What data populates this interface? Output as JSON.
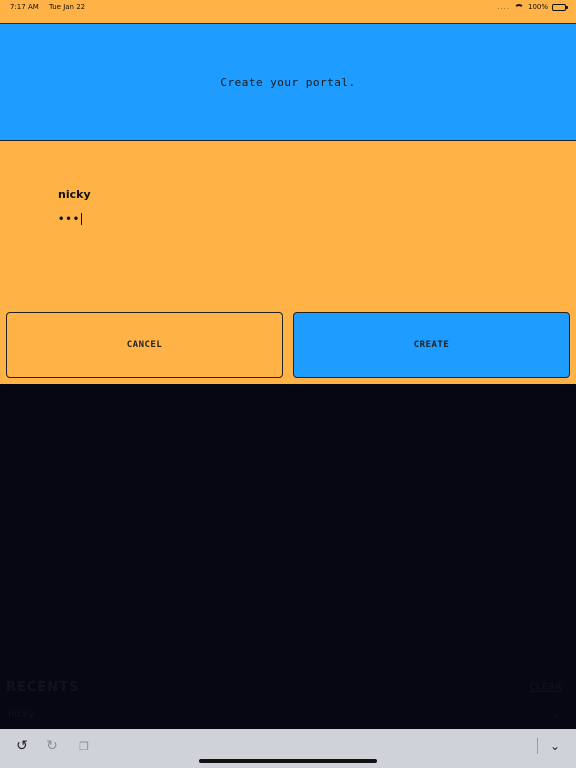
{
  "status_bar": {
    "time": "7:17 AM",
    "date": "Tue Jan 22",
    "dots": "....",
    "battery": "100%"
  },
  "header": {
    "title": "Create your portal."
  },
  "form": {
    "username": "nicky",
    "password_mask": "•••"
  },
  "buttons": {
    "cancel_label": "CANCEL",
    "create_label": "CREATE"
  },
  "background": {
    "recents_title": "RECENTS",
    "recents_action": "CLEAR",
    "recent_item": "nicky",
    "recent_chevron": "›"
  },
  "toolbar": {
    "undo_glyph": "↺",
    "redo_glyph": "↻",
    "copy_glyph": "❐",
    "collapse_glyph": "⌄"
  },
  "colors": {
    "orange": "#ffb347",
    "blue": "#1e9cff",
    "dark": "#060712",
    "toolbar": "#cfd2d8"
  }
}
